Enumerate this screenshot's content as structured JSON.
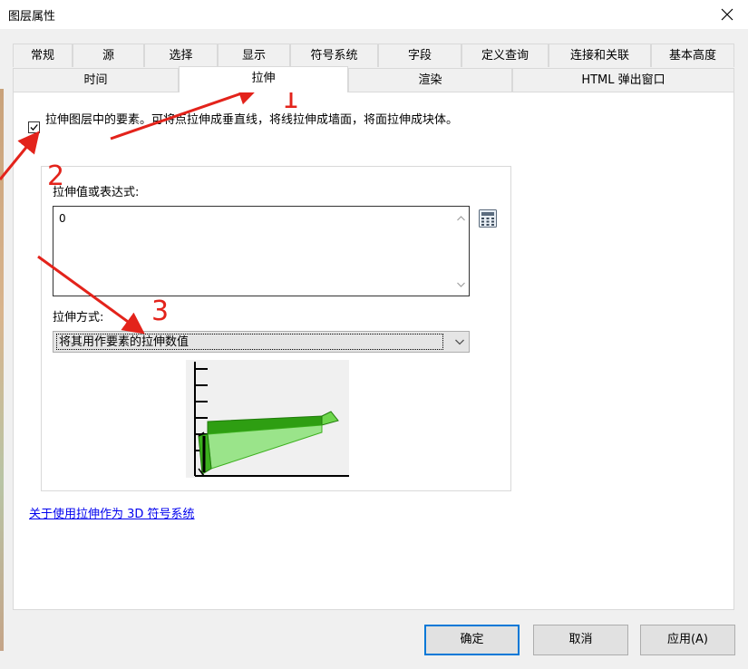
{
  "window": {
    "title": "图层属性",
    "close_glyph": "✕"
  },
  "tabs_row1": [
    "常规",
    "源",
    "选择",
    "显示",
    "符号系统",
    "字段",
    "定义查询",
    "连接和关联",
    "基本高度"
  ],
  "tabs_row2": [
    "时间",
    "拉伸",
    "渲染",
    "HTML 弹出窗口"
  ],
  "active_tab": "拉伸",
  "extrusion": {
    "checkbox_checked": true,
    "checkbox_label": "拉伸图层中的要素。可将点拉伸成垂直线，将线拉伸成墙面，将面拉伸成块体。",
    "expression_label": "拉伸值或表达式:",
    "expression_value": "0",
    "method_label": "拉伸方式:",
    "method_selected": "将其用作要素的拉伸数值"
  },
  "help_link": "关于使用拉伸作为 3D 符号系统",
  "buttons": {
    "ok": "确定",
    "cancel": "取消",
    "apply": "应用(A)"
  },
  "annotations": [
    "1",
    "2",
    "3"
  ],
  "colors": {
    "annotation_red": "#e3231b",
    "focus_blue": "#0078d7",
    "link_blue": "#0000ee",
    "extrude_green": "#3cb01e"
  }
}
